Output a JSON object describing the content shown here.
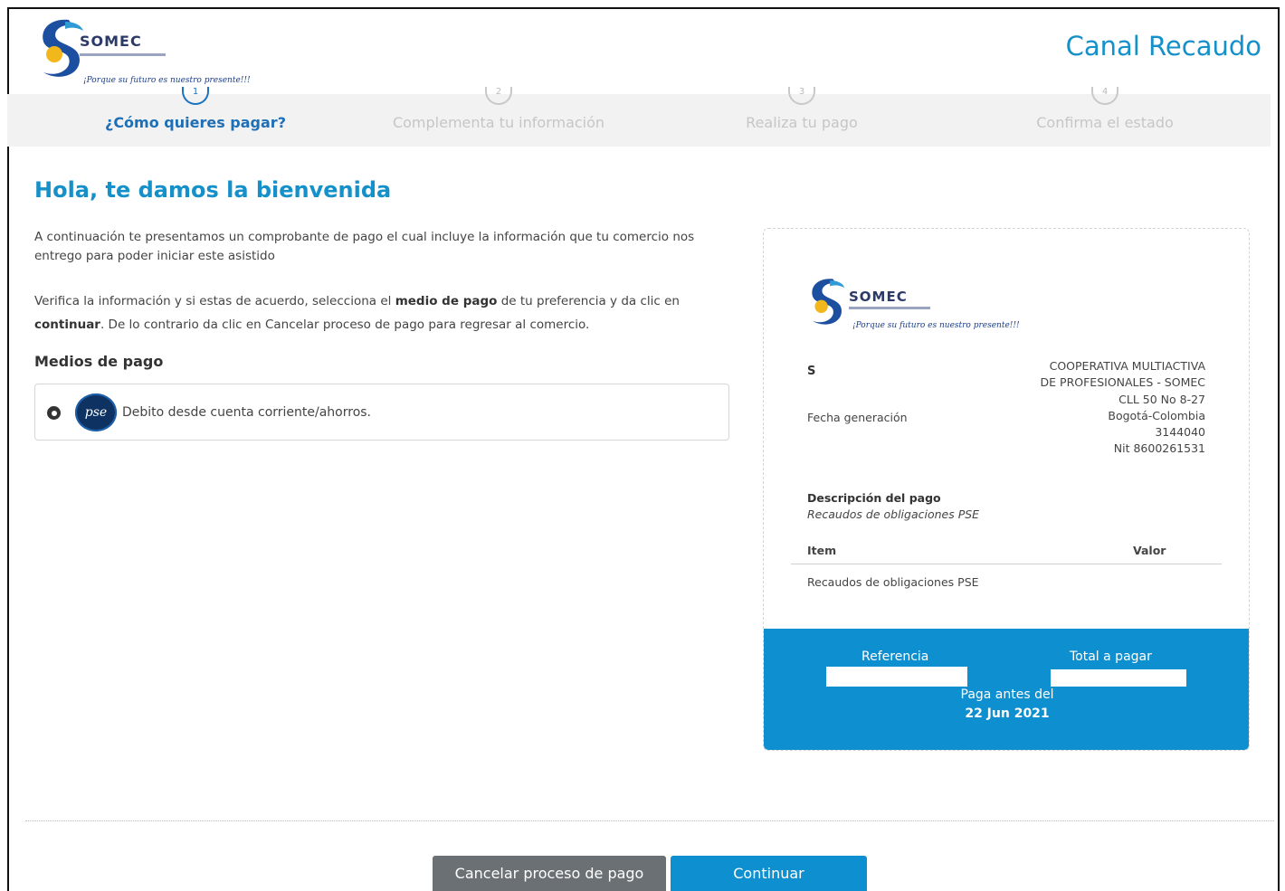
{
  "header": {
    "brand": "SOMEC",
    "slogan": "¡Porque su futuro es nuestro presente!!!",
    "app_title": "Canal Recaudo"
  },
  "stepper": {
    "steps": [
      {
        "number": "1",
        "label": "¿Cómo quieres pagar?",
        "active": true
      },
      {
        "number": "2",
        "label": "Complementa tu información",
        "active": false
      },
      {
        "number": "3",
        "label": "Realiza tu pago",
        "active": false
      },
      {
        "number": "4",
        "label": "Confirma el estado",
        "active": false
      }
    ]
  },
  "main": {
    "welcome": "Hola, te damos la bienvenida",
    "intro": "A continuación te presentamos un comprobante de pago el cual incluye la información que tu comercio nos entrego para poder iniciar este asistido",
    "instructions": {
      "part1": "Verifica la información y si estas de acuerdo, selecciona el ",
      "bold1": "medio de pago",
      "part2": " de tu preferencia y da clic en ",
      "bold2": "continuar",
      "part3": ". De lo contrario da clic en Cancelar proceso de pago para regresar al comercio."
    },
    "methods_title": "Medios de pago",
    "payment_method": {
      "logo_text": "pse",
      "label": "Debito desde cuenta corriente/ahorros."
    }
  },
  "receipt": {
    "brand": "SOMEC",
    "slogan": "¡Porque su futuro es nuestro presente!!!",
    "code": "S",
    "fecha_label": "Fecha generación",
    "company": [
      "COOPERATIVA MULTIACTIVA",
      "DE PROFESIONALES - SOMEC",
      "CLL 50 No 8-27",
      "Bogotá-Colombia",
      "3144040",
      "Nit 8600261531"
    ],
    "desc_title": "Descripción del pago",
    "desc_value": "Recaudos de obligaciones PSE",
    "table": {
      "col_item": "Item",
      "col_valor": "Valor",
      "rows": [
        {
          "item": "Recaudos de obligaciones PSE",
          "valor": ""
        }
      ]
    },
    "footer": {
      "ref_label": "Referencia",
      "total_label": "Total a pagar",
      "due_label": "Paga antes del",
      "due_date": "22 Jun 2021"
    }
  },
  "actions": {
    "cancel_label": "Cancelar proceso de pago",
    "continue_label": "Continuar"
  },
  "colors": {
    "accent": "#1590c9",
    "receipt_footer": "#0e8fcf",
    "cancel_button": "#6b7075",
    "active_step": "#1e6fb5"
  }
}
